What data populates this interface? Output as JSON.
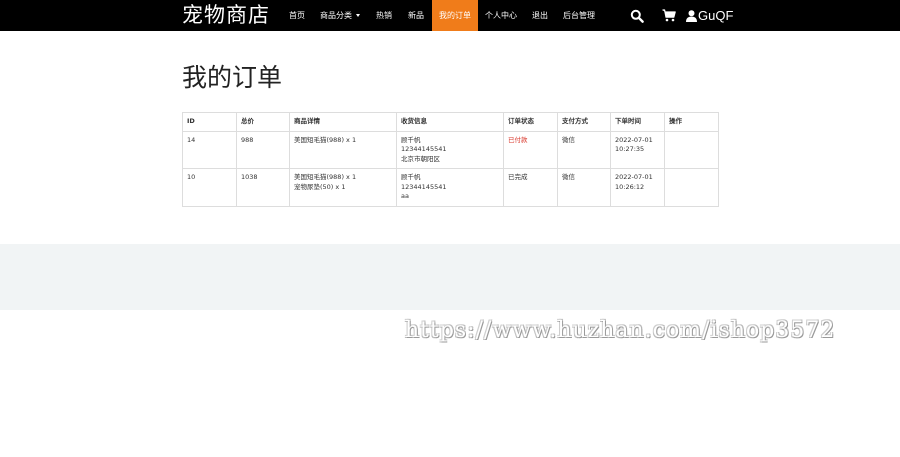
{
  "brand": "宠物商店",
  "nav": {
    "items": [
      {
        "label": "首页"
      },
      {
        "label": "商品分类"
      },
      {
        "label": "热销"
      },
      {
        "label": "新品"
      },
      {
        "label": "我的订单"
      },
      {
        "label": "个人中心"
      },
      {
        "label": "退出"
      },
      {
        "label": "后台管理"
      }
    ],
    "username": "GuQF",
    "accent": "#f07c1a"
  },
  "page_title": "我的订单",
  "table": {
    "headers": [
      "ID",
      "总价",
      "商品详情",
      "收货信息",
      "订单状态",
      "支付方式",
      "下单时间",
      "操作"
    ],
    "rows": [
      {
        "id": "14",
        "total": "988",
        "items": [
          "美国短毛猫(988) x 1"
        ],
        "shipping": [
          "顾千帆",
          "12344145541",
          "北京市朝阳区"
        ],
        "status": "已付款",
        "payment": "微信",
        "time": [
          "2022-07-01",
          "10:27:35"
        ]
      },
      {
        "id": "10",
        "total": "1038",
        "items": [
          "美国短毛猫(988) x 1",
          "宠物尿垫(50) x 1"
        ],
        "shipping": [
          "顾千帆",
          "12344145541",
          "aa"
        ],
        "status": "已完成",
        "payment": "微信",
        "time": [
          "2022-07-01",
          "10:26:12"
        ]
      }
    ]
  },
  "watermark": "https://www.huzhan.com/ishop3572",
  "colors": {
    "status_paid": "#d9372b",
    "footer_band": "#f1f4f5"
  }
}
